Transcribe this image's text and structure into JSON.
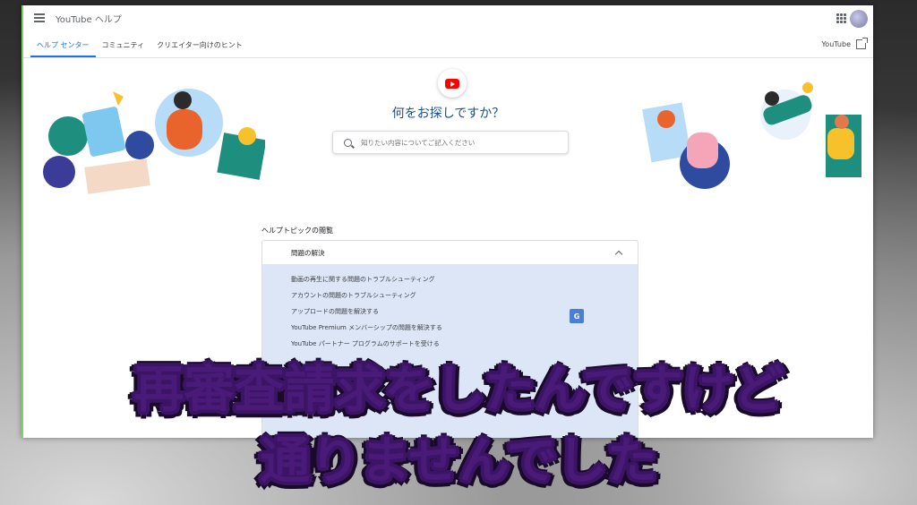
{
  "app": {
    "title": "YouTube ヘルプ"
  },
  "tabs": [
    {
      "label": "ヘルプ センター",
      "active": true
    },
    {
      "label": "コミュニティ",
      "active": false
    },
    {
      "label": "クリエイター向けのヒント",
      "active": false
    }
  ],
  "header": {
    "youtube_link": "YouTube"
  },
  "hero": {
    "title": "何をお探しですか？",
    "search_placeholder": "知りたい内容についてご記入ください"
  },
  "topics": {
    "label": "ヘルプトピックの閲覧",
    "section_title": "問題の解決",
    "items": [
      "動画の再生に関する問題のトラブルシューティング",
      "アカウントの問題のトラブルシューティング",
      "アップロードの問題を解決する",
      "YouTube Premium メンバーシップの問題を解決する",
      "YouTube パートナー プログラムのサポートを受ける"
    ]
  },
  "caption": {
    "line1": "再審査請求をしたんですけど",
    "line2": "通りませんでした"
  },
  "colors": {
    "accent": "#1a73e8",
    "youtube_red": "#ff0000",
    "caption_fill": "#8a4fd0"
  }
}
